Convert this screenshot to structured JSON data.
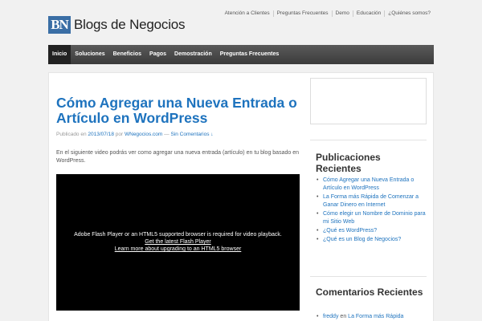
{
  "header": {
    "logo_mark": "BN",
    "site_title": "Blogs de Negocios",
    "top_links": [
      "Atención a Clientes",
      "Preguntas Frecuentes",
      "Demo",
      "Educación",
      "¿Quiénes somos?"
    ]
  },
  "nav": {
    "items": [
      "Inicio",
      "Soluciones",
      "Beneficios",
      "Pagos",
      "Demostración",
      "Preguntas Frecuentes"
    ],
    "active": "Inicio"
  },
  "post": {
    "title": "Cómo Agregar una Nueva Entrada o Artículo en WordPress",
    "meta_prefix": "Publicado en",
    "date": "2013/07/18",
    "meta_by": "por",
    "author": "WNegocios.com",
    "meta_dash": "—",
    "comments_link": "Sin Comentarios ↓",
    "body": "En el siguiente video podrás ver como agregar una nueva entrada (artículo) en tu blog basado en WordPress."
  },
  "video": {
    "message": "Adobe Flash Player or an HTML5 supported browser is required for video playback.",
    "link1": "Get the latest Flash Player",
    "link2": "Learn more about upgrading to an HTML5 browser"
  },
  "sidebar": {
    "recent_title": "Publicaciones Recientes",
    "recent_posts": [
      "Cómo Agregar una Nueva Entrada o Artículo en WordPress",
      "La Forma más Rápida de Comenzar a Ganar Dinero en Internet",
      "Cómo elegir un Nombre de Dominio para mi Sitio Web",
      "¿Qué es WordPress?",
      "¿Qué es un Blog de Negocios?"
    ],
    "comments_title": "Comentarios Recientes",
    "comment": {
      "author": "freddy",
      "conj": "en",
      "post": "La Forma más Rápida"
    }
  },
  "colors": {
    "link": "#1e73be",
    "nav_bg": "#444444",
    "nav_active": "#222222",
    "logo_bg": "#3a6ea5"
  }
}
